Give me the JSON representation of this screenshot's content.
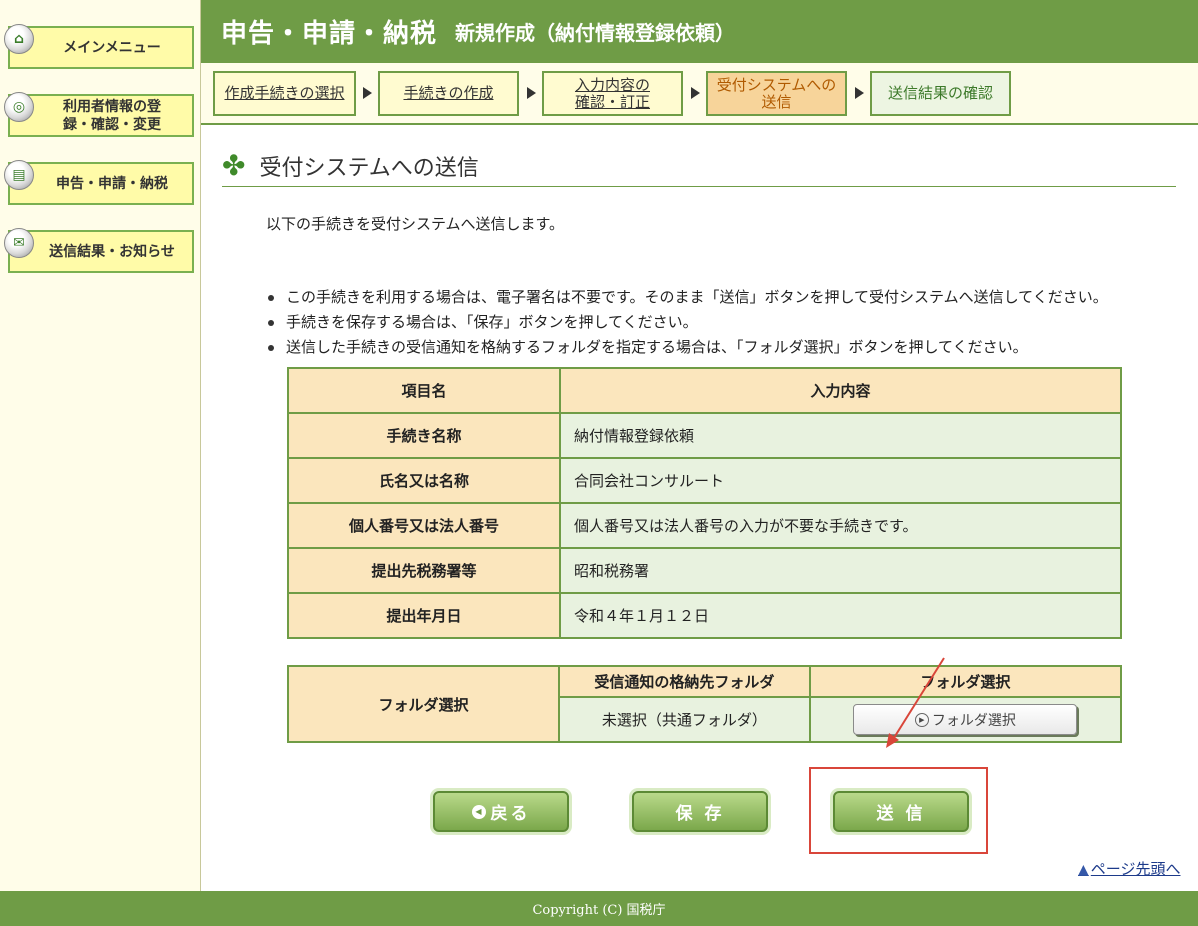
{
  "sidebar": {
    "items": [
      {
        "label": "メインメニュー",
        "icon": "home-icon"
      },
      {
        "label": "利用者情報の登録・確認・変更",
        "icon": "user-info-icon"
      },
      {
        "label": "申告・申請・納税",
        "icon": "document-icon"
      },
      {
        "label": "送信結果・お知らせ",
        "icon": "mail-icon"
      }
    ]
  },
  "header": {
    "title": "申告・申請・納税",
    "subtitle": "新規作成（納付情報登録依頼）"
  },
  "steps": [
    {
      "label": "作成手続きの選択",
      "state": "done"
    },
    {
      "label": "手続きの作成",
      "state": "done"
    },
    {
      "label": "入力内容の確認・訂正",
      "state": "done"
    },
    {
      "label": "受付システムへの送信",
      "state": "current"
    },
    {
      "label": "送信結果の確認",
      "state": "future"
    }
  ],
  "section_title": "受付システムへの送信",
  "intro": "以下の手続きを受付システムへ送信します。",
  "notes": [
    "この手続きを利用する場合は、電子署名は不要です。そのまま「送信」ボタンを押して受付システムへ送信してください。",
    "手続きを保存する場合は、「保存」ボタンを押してください。",
    "送信した手続きの受信通知を格納するフォルダを指定する場合は、「フォルダ選択」ボタンを押してください。"
  ],
  "info_table": {
    "headers": [
      "項目名",
      "入力内容"
    ],
    "rows": [
      {
        "label": "手続き名称",
        "value": "納付情報登録依頼"
      },
      {
        "label": "氏名又は名称",
        "value": "合同会社コンサルート"
      },
      {
        "label": "個人番号又は法人番号",
        "value": "個人番号又は法人番号の入力が不要な手続きです。"
      },
      {
        "label": "提出先税務署等",
        "value": "昭和税務署"
      },
      {
        "label": "提出年月日",
        "value": "令和４年１月１２日"
      }
    ]
  },
  "folder_table": {
    "row_header": "フォルダ選択",
    "col_headers": [
      "受信通知の格納先フォルダ",
      "フォルダ選択"
    ],
    "folder_value": "未選択（共通フォルダ）",
    "button_label": "フォルダ選択"
  },
  "actions": {
    "back": "戻る",
    "save": "保 存",
    "send": "送 信"
  },
  "page_top": "ページ先頭へ",
  "footer": "Copyright (C) 国税庁",
  "colors": {
    "brand_green": "#6f9c46",
    "table_header": "#fbe6bd",
    "table_cell": "#e8f2df",
    "highlight_red": "#d9463a"
  }
}
